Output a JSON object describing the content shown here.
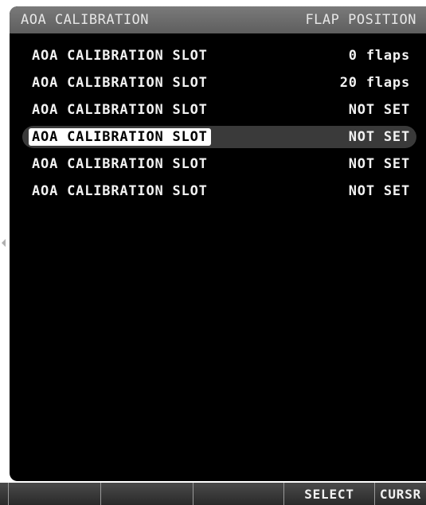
{
  "header": {
    "title": "AOA CALIBRATION",
    "column_title": "FLAP POSITION"
  },
  "slots": [
    {
      "label": "AOA CALIBRATION SLOT",
      "value": "0 flaps",
      "selected": false
    },
    {
      "label": "AOA CALIBRATION SLOT",
      "value": "20 flaps",
      "selected": false
    },
    {
      "label": "AOA CALIBRATION SLOT",
      "value": "NOT SET",
      "selected": false
    },
    {
      "label": "AOA CALIBRATION SLOT",
      "value": "NOT SET",
      "selected": true
    },
    {
      "label": "AOA CALIBRATION SLOT",
      "value": "NOT SET",
      "selected": false
    },
    {
      "label": "AOA CALIBRATION SLOT",
      "value": "NOT SET",
      "selected": false
    }
  ],
  "softkeys": [
    "",
    "",
    "",
    "SELECT",
    "CURSR"
  ],
  "colors": {
    "screen_bg": "#000000",
    "title_bar": "#6b6b6b",
    "text": "#f2f2f2",
    "highlight_bg": "#ffffff",
    "highlight_text": "#000000"
  }
}
